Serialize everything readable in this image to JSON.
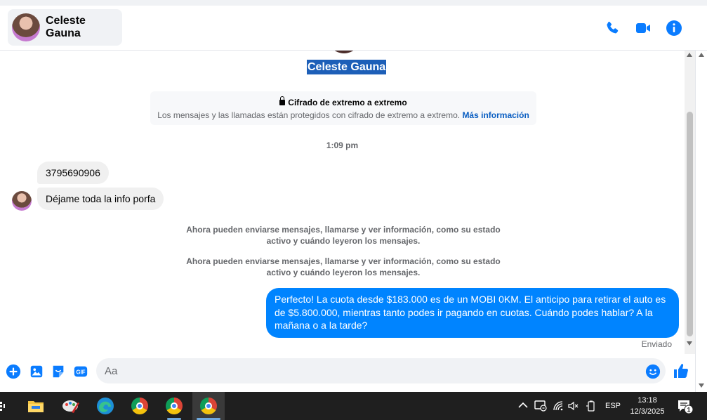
{
  "header": {
    "contact_name": "Celeste Gauna",
    "accent_color": "#0084ff"
  },
  "chat": {
    "profile_name": "Celeste Gauna",
    "e2e": {
      "title": "Cifrado de extremo a extremo",
      "description": "Los mensajes y las llamadas están protegidos con cifrado de extremo a extremo.",
      "link": "Más información"
    },
    "timestamp": "1:09 pm",
    "incoming": [
      "3795690906",
      "Déjame toda la info porfa"
    ],
    "system_messages": [
      "Ahora pueden enviarse mensajes, llamarse y ver información, como su estado activo y cuándo leyeron los mensajes.",
      "Ahora pueden enviarse mensajes, llamarse y ver información, como su estado activo y cuándo leyeron los mensajes."
    ],
    "outgoing": "Perfecto! La cuota desde $183.000 es de un MOBI 0KM. El anticipo para retirar el auto es de $5.800.000, mientras tanto podes ir pagando en cuotas. Cuándo podes hablar? A la mañana o a la tarde?",
    "sent_status": "Enviado"
  },
  "composer": {
    "placeholder": "Aa",
    "gif_label": "GIF"
  },
  "taskbar": {
    "language": "ESP",
    "time": "13:18",
    "date": "12/3/2025",
    "notification_count": "1"
  }
}
